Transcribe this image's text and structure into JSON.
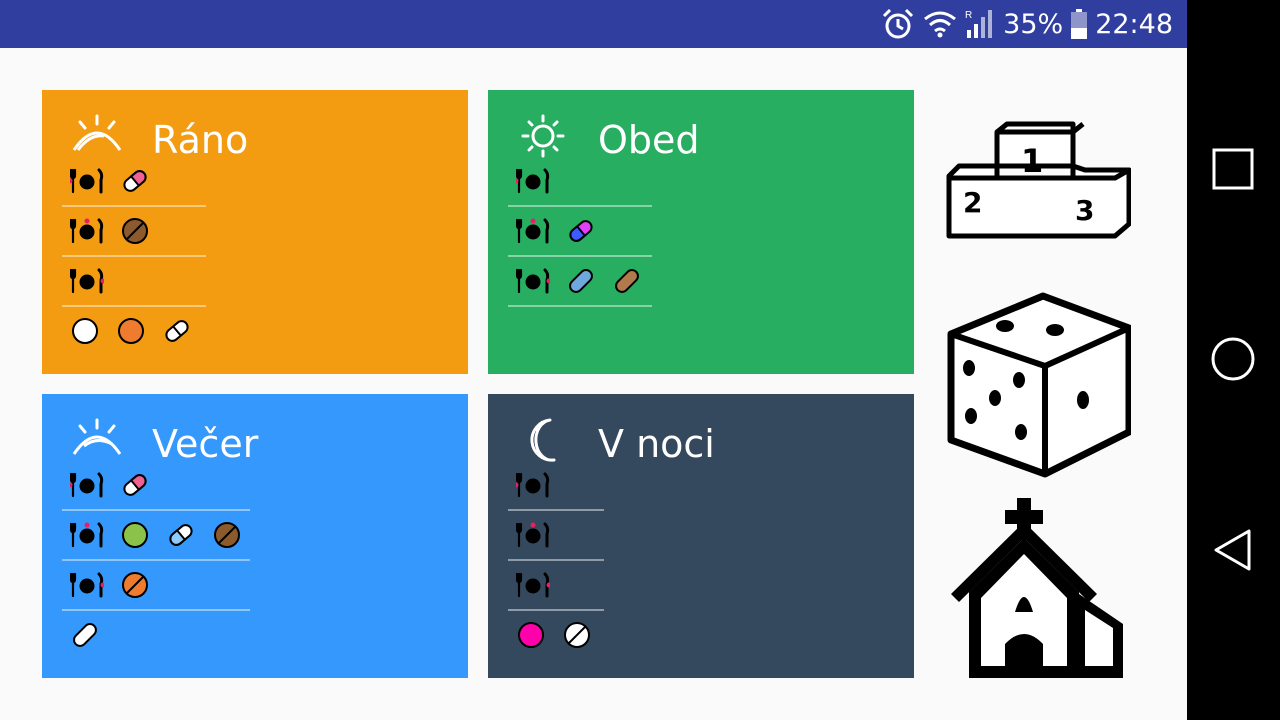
{
  "status_bar": {
    "battery_percent": "35%",
    "time": "22:48",
    "icons": [
      "alarm-icon",
      "wifi-icon",
      "cell-signal-icon",
      "battery-icon"
    ]
  },
  "cards": [
    {
      "title": "Ráno",
      "color": "#f39c12",
      "icon": "sunrise-icon"
    },
    {
      "title": "Obed",
      "color": "#27ae60",
      "icon": "sun-icon"
    },
    {
      "title": "Večer",
      "color": "#3498fd",
      "icon": "sunset-icon"
    },
    {
      "title": "V noci",
      "color": "#34495e",
      "icon": "moon-icon"
    }
  ],
  "side_buttons": [
    "podium-icon",
    "dice-icon",
    "church-icon"
  ],
  "nav": [
    "recent-apps-button",
    "home-button",
    "back-button"
  ]
}
